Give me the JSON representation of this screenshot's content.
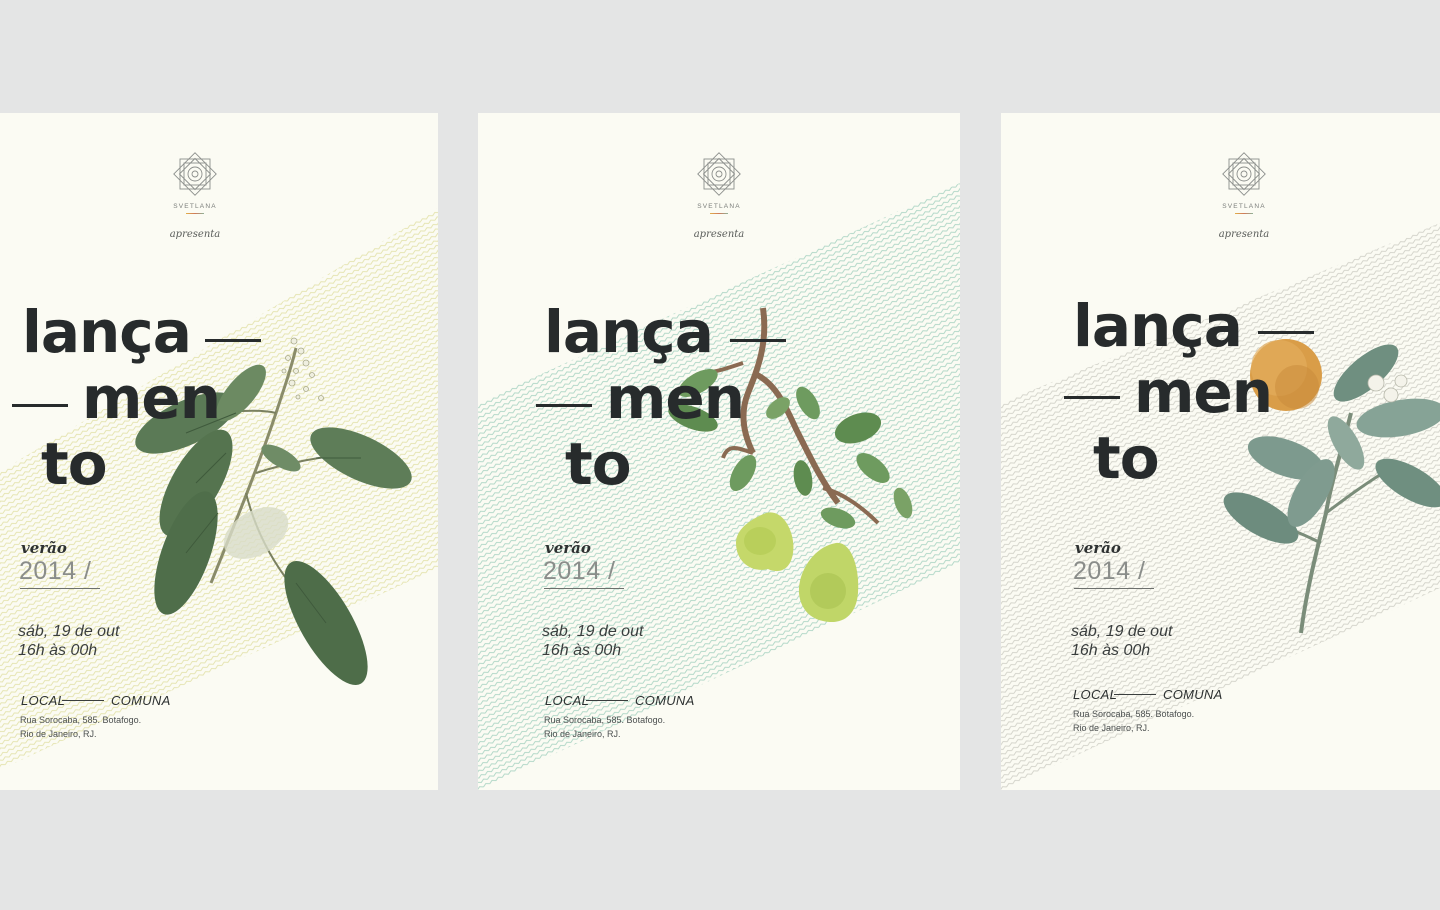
{
  "posters": [
    {
      "brand": "SVETLANA",
      "presents": "apresenta",
      "title": {
        "line1": "lança",
        "line2": "men",
        "line3": "to"
      },
      "season": "verão",
      "year": "2014 /",
      "date": "sáb, 19 de out",
      "time": "16h às 00h",
      "venue": {
        "label": "LOCAL",
        "name": "COMUNA"
      },
      "address": {
        "line1": "Rua Sorocaba, 585. Botafogo.",
        "line2": "Rio de Janeiro, RJ."
      },
      "illustration": "flowering-branch-illustration",
      "band_color": "#e8e7b8"
    },
    {
      "brand": "SVETLANA",
      "presents": "apresenta",
      "title": {
        "line1": "lança",
        "line2": "men",
        "line3": "to"
      },
      "season": "verão",
      "year": "2014 /",
      "date": "sáb, 19 de out",
      "time": "16h às 00h",
      "venue": {
        "label": "LOCAL",
        "name": "COMUNA"
      },
      "address": {
        "line1": "Rua Sorocaba, 585. Botafogo.",
        "line2": "Rio de Janeiro, RJ."
      },
      "illustration": "pear-branch-illustration",
      "band_color": "#b9dccc"
    },
    {
      "brand": "SVETLANA",
      "presents": "apresenta",
      "title": {
        "line1": "lança",
        "line2": "men",
        "line3": "to"
      },
      "season": "verão",
      "year": "2014 /",
      "date": "sáb, 19 de out",
      "time": "16h às 00h",
      "venue": {
        "label": "LOCAL",
        "name": "COMUNA"
      },
      "address": {
        "line1": "Rua Sorocaba, 585. Botafogo.",
        "line2": "Rio de Janeiro, RJ."
      },
      "illustration": "orange-branch-illustration",
      "band_color": "#d6d6ce"
    }
  ]
}
